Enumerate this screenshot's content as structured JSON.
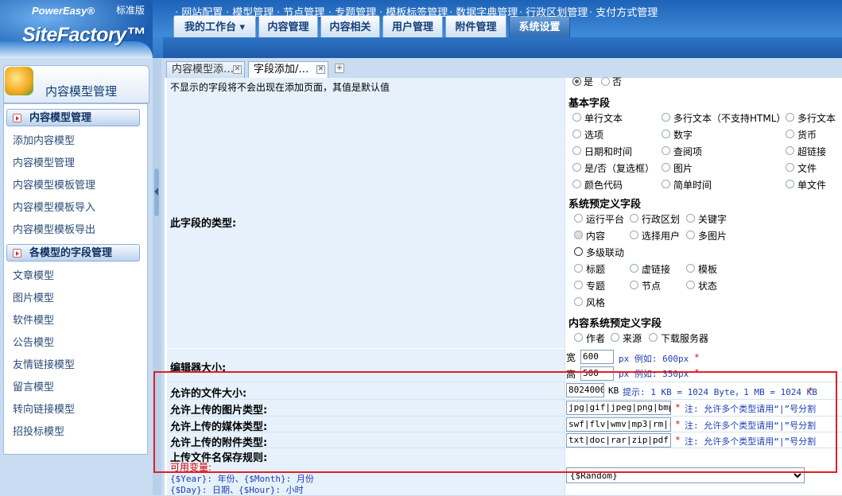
{
  "logo": {
    "brand": "PowerEasy®",
    "name": "SiteFactory™",
    "edition": "标准版"
  },
  "main_tabs": [
    {
      "label": "我的工作台 ▾"
    },
    {
      "label": "内容管理"
    },
    {
      "label": "内容相关"
    },
    {
      "label": "用户管理"
    },
    {
      "label": "附件管理"
    },
    {
      "label": "系统设置",
      "active": true
    }
  ],
  "sub_nav": [
    "网站配置",
    "模型管理",
    "节点管理",
    "专题管理",
    "模板标签管理",
    "数据字典管理",
    "行政区划管理",
    "支付方式管理"
  ],
  "sidebar": {
    "title": "内容模型管理",
    "sections": [
      {
        "title": "内容模型管理",
        "items": [
          "添加内容模型",
          "内容模型管理",
          "内容模型模板管理",
          "内容模型模板导入",
          "内容模型模板导出"
        ]
      },
      {
        "title": "各模型的字段管理",
        "items": [
          "文章模型",
          "图片模型",
          "软件模型",
          "公告模型",
          "友情链接模型",
          "留言模型",
          "转向链接模型",
          "招投标模型"
        ]
      }
    ]
  },
  "content_tabs": [
    {
      "label": "内容模型添…"
    },
    {
      "label": "字段添加/…",
      "active": true
    }
  ],
  "form": {
    "top_note": "不显示的字段将不会出现在添加页面，其值是默认值",
    "top_radio_yes": "是",
    "top_radio_no": "否",
    "field_type_label": "此字段的类型:",
    "basic_group": "基本字段",
    "basic_fields": [
      "单行文本",
      "多行文本（不支持HTML）",
      "多行文本（",
      "选项",
      "数字",
      "货币",
      "日期和时间",
      "查阅项",
      "超链接",
      "是/否（复选框）",
      "图片",
      "文件",
      "颜色代码",
      "简单时间",
      "单文件"
    ],
    "system_group": "系统预定义字段",
    "system_fields": [
      "运行平台",
      "行政区划",
      "关键字",
      "内容",
      "选择用户",
      "多图片",
      "多级联动",
      "标题",
      "虚链接",
      "模板",
      "专题",
      "节点",
      "状态",
      "风格"
    ],
    "content_group": "内容系统预定义字段",
    "content_fields": [
      "作者",
      "来源",
      "下载服务器"
    ],
    "editor_size_label": "编辑器大小:",
    "width_label": "宽",
    "width_value": "600",
    "width_hint": "px  例如: 600px",
    "height_label": "高",
    "height_value": "500",
    "height_hint": "px  例如: 350px",
    "file_size_label": "允许的文件大小:",
    "file_size_value": "8024000",
    "file_size_unit": "KB",
    "file_size_hint": "提示: 1 KB = 1024 Byte，1 MB = 1024 KB",
    "image_types_label": "允许上传的图片类型:",
    "image_types_value": "jpg|gif|jpeg|png|bmp",
    "media_types_label": "允许上传的媒体类型:",
    "media_types_value": "swf|flv|wmv|mp3|rm|rm",
    "attach_types_label": "允许上传的附件类型:",
    "attach_types_value": "txt|doc|rar|zip|pdf|d",
    "types_hint": "注: 允许多个类型请用“|”号分割",
    "required_mark": "*",
    "save_rule_label": "上传文件名保存规则:",
    "vars_label": "可用变量:",
    "vars_line1": "{$Year}: 年份、{$Month}: 月份",
    "vars_line2": "{$Day}: 日期、{$Hour}: 小时",
    "save_rule_value": "{$Random}"
  }
}
